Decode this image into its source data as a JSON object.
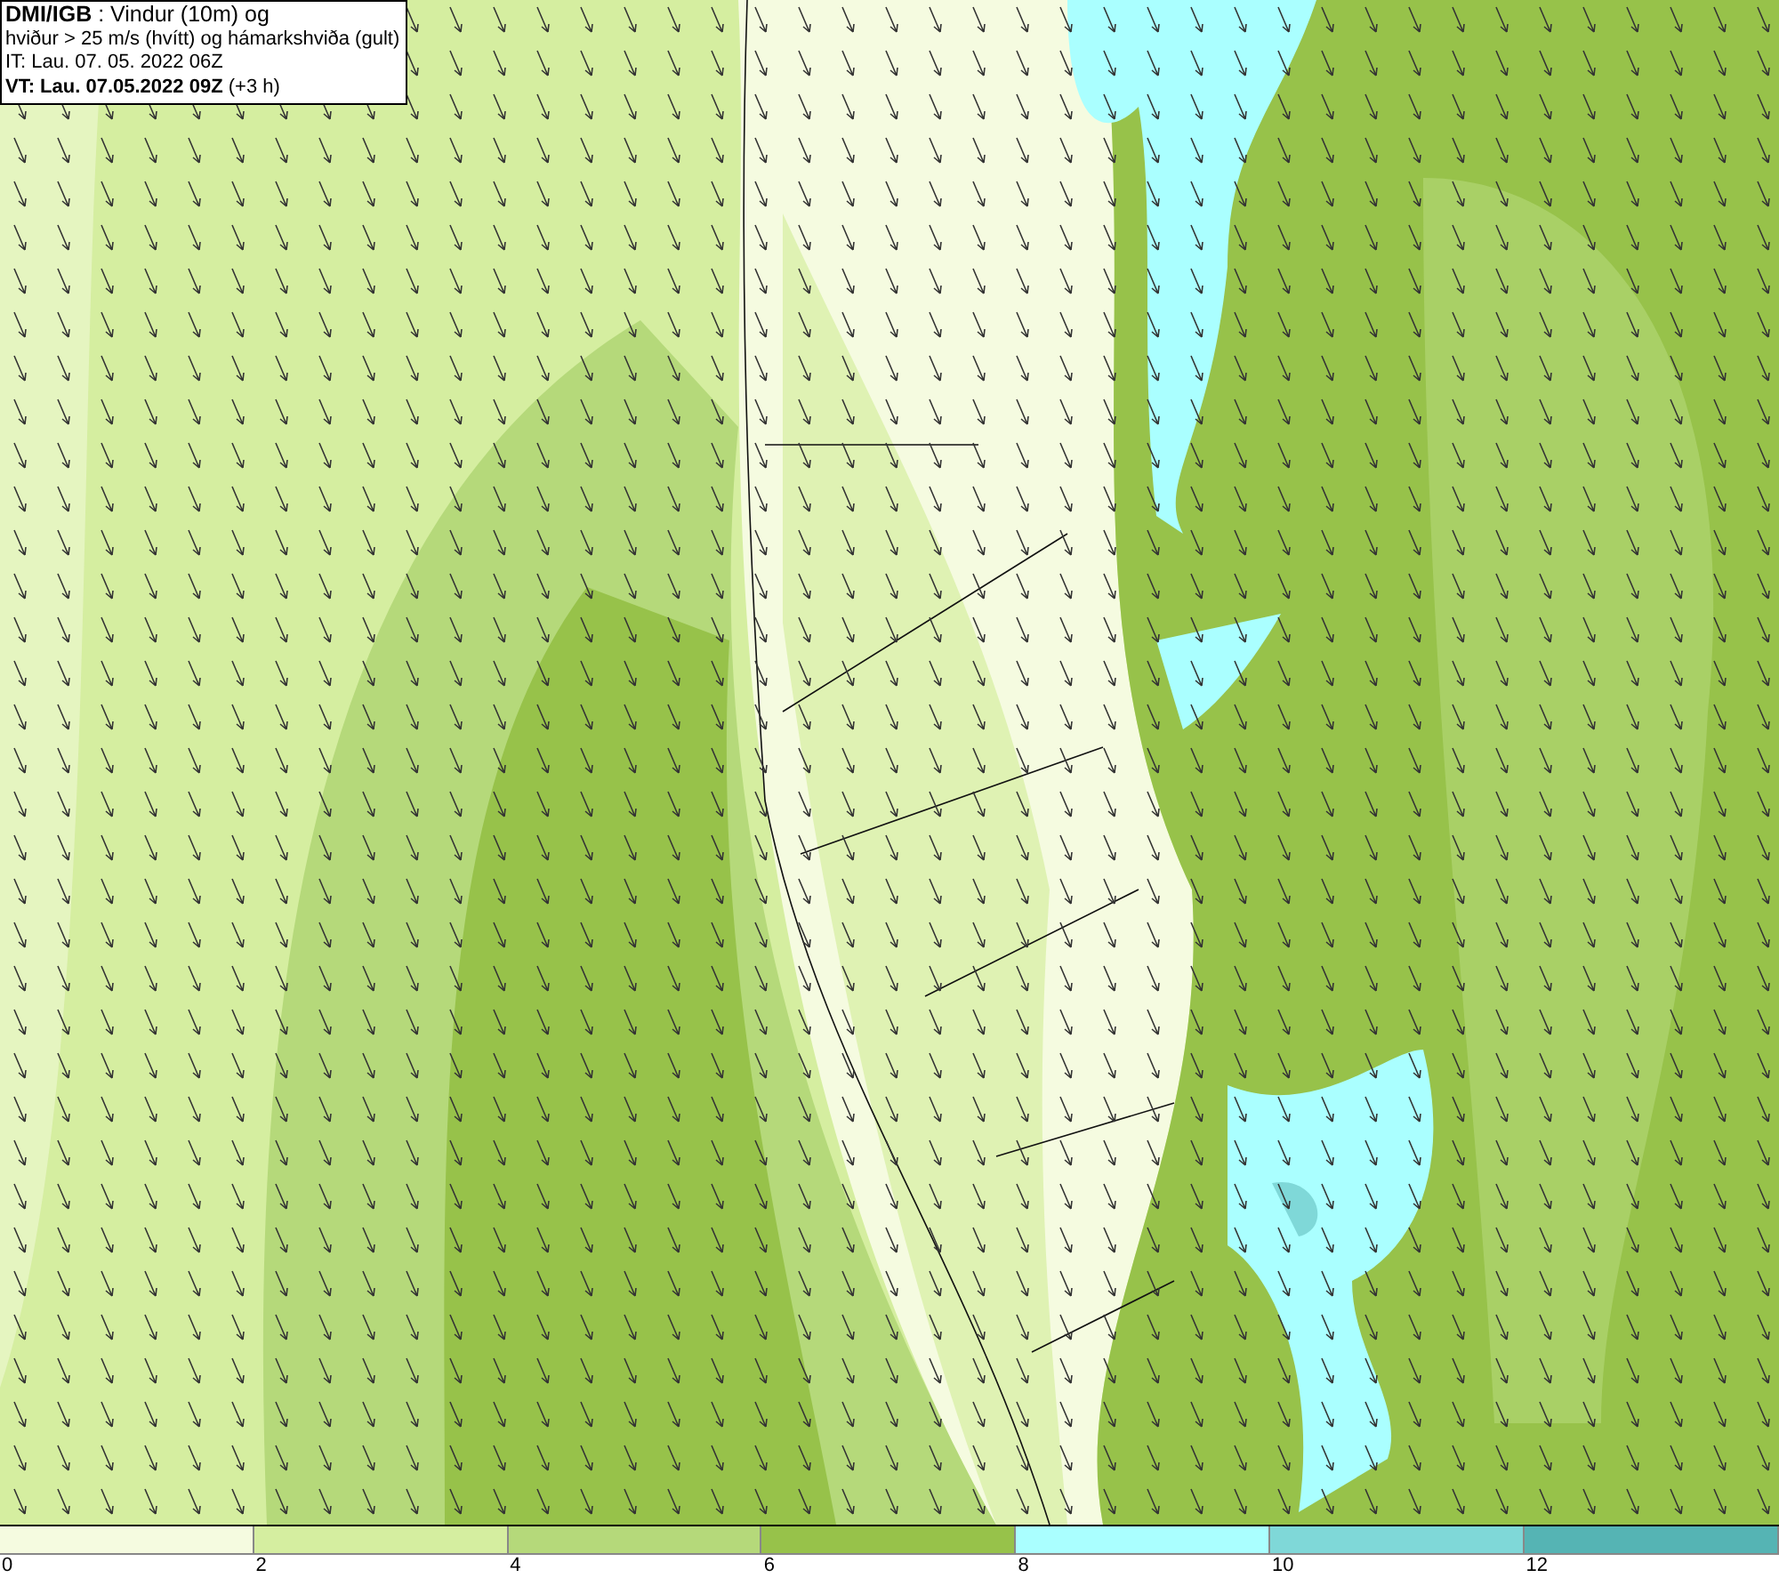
{
  "title_box": {
    "lines": [
      "**DMI/IGB** : Vindur (10m) og",
      "hviður > 25 m/s (hvítt) og hámarkshviða (gult)",
      "IT: Lau. 07. 05. 2022 06Z",
      "**VT: Lau. 07.05.2022 09Z** (+3 h)"
    ]
  },
  "legend": {
    "bins": [
      {
        "color": "#f5fbe0"
      },
      {
        "color": "#d5eea0"
      },
      {
        "color": "#b5d97a"
      },
      {
        "color": "#97c24a"
      },
      {
        "color": "#aaffff"
      },
      {
        "color": "#7fd8d8"
      },
      {
        "color": "#55b4b4"
      }
    ],
    "ticks": [
      "0",
      "2",
      "4",
      "6",
      "8",
      "10",
      "12"
    ]
  }
}
